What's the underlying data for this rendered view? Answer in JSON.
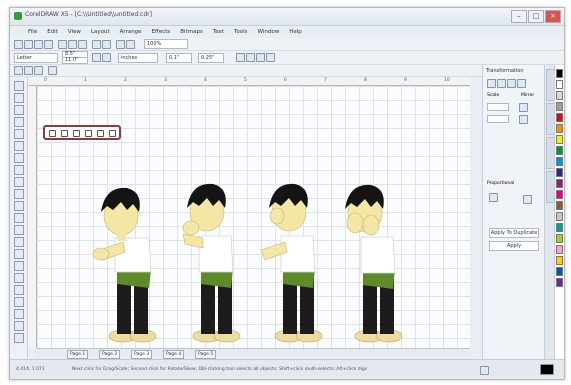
{
  "window": {
    "title": "CorelDRAW X5 - [C:\\\\Untitled\\\\untitled.cdr]",
    "buttons": [
      "–",
      "□",
      "×"
    ]
  },
  "menubar": [
    "File",
    "Edit",
    "View",
    "Layout",
    "Arrange",
    "Effects",
    "Bitmaps",
    "Text",
    "Tools",
    "Window",
    "Help"
  ],
  "toolbar": {
    "font_value": "Letter",
    "width_value": "8.5\"",
    "height_value": "11.0\"",
    "units_value": "inches",
    "nudge_value": "0.1\"",
    "dup_value": "0.25\"",
    "zoom_value": "100%"
  },
  "ruler": {
    "ticks": [
      "0",
      "1",
      "2",
      "3",
      "4",
      "5",
      "6",
      "7",
      "8",
      "9",
      "10"
    ]
  },
  "canvas": {
    "figure_count": 4,
    "mirror_icons": [
      "mirror-h-icon",
      "mirror-v-icon",
      "rotate-icon",
      "flip-icon",
      "align-icon",
      "node-icon"
    ]
  },
  "docker": {
    "title": "Transformation",
    "labels": [
      "Scale",
      "Mirror",
      "Proportional"
    ],
    "apply_to_duplicate": "Apply To Duplicate",
    "apply": "Apply"
  },
  "page_tabs": [
    "Page 1",
    "Page 2",
    "Page 3",
    "Page 4",
    "Page 5"
  ],
  "status": {
    "coords": "4.414, 1.071",
    "hint": "Next click for Drag/Scale; Second click for Rotate/Skew; Dbl-clicking tool selects all objects; Shift+click multi-selects; Alt+click digs"
  },
  "colors": {
    "hair": "#141414",
    "skin": "#f4e6a4",
    "shirt": "#ffffff",
    "sash": "#5f8a2a",
    "pants": "#1d1b1b",
    "shoe": "#ecdca0",
    "highlight_border": "#8c3a3a"
  },
  "palette": [
    "#000000",
    "#ffffff",
    "#d9d9d9",
    "#9e9e9e",
    "#e30613",
    "#f39200",
    "#ffed00",
    "#009640",
    "#0096d6",
    "#312783",
    "#951b81",
    "#e6007e",
    "#8c5d2e",
    "#c6c6c6",
    "#00a19a",
    "#a3c93a",
    "#f7a8b8",
    "#ffcd00",
    "#005ca9",
    "#6b2c91"
  ]
}
